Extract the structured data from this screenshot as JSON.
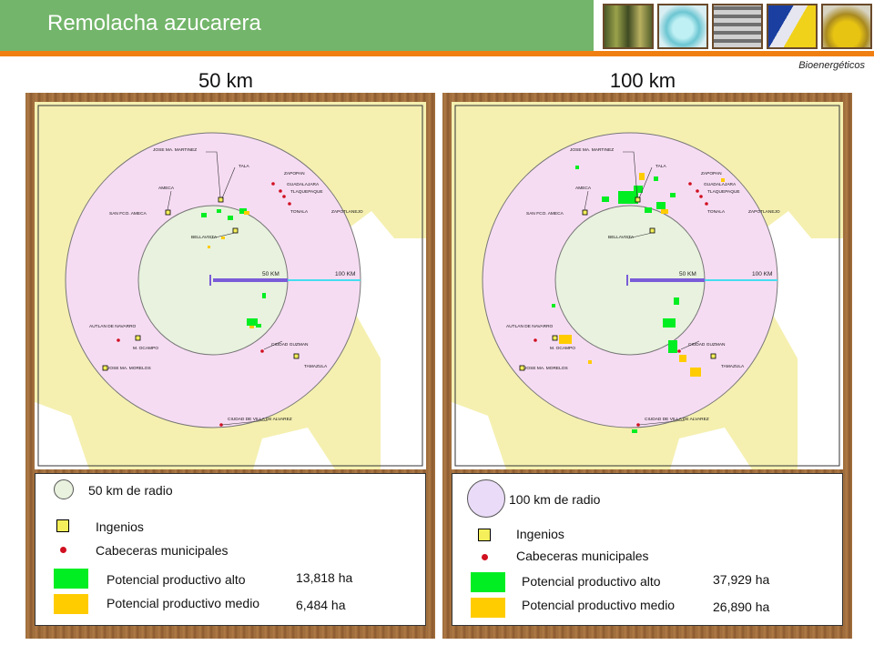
{
  "header": {
    "title": "Remolacha azucarera",
    "brand": "Bioenergéticos"
  },
  "colors": {
    "green_bar": "#73b56a",
    "orange_line": "#f07f12",
    "circle_50": "#e8f2de",
    "circle_100": "#f6dcf3",
    "yellow_land": "#f5f0b0",
    "high": "#00ee22",
    "medium": "#ffcc00"
  },
  "maps": [
    {
      "title": "50 km",
      "legend": {
        "radius_label": "50 km de radio",
        "mills": "Ingenios",
        "towns": "Cabeceras municipales",
        "high_label": "Potencial productivo alto",
        "medium_label": "Potencial productivo medio",
        "high_value": "13,818 ha",
        "medium_value": "6,484 ha"
      }
    },
    {
      "title": "100 km",
      "legend": {
        "radius_label": "100 km de radio",
        "mills": "Ingenios",
        "towns": "Cabeceras municipales",
        "high_label": "Potencial productivo alto",
        "medium_label": "Potencial productivo medio",
        "high_value": "37,929 ha",
        "medium_value": "26,890 ha"
      }
    }
  ],
  "map_labels": {
    "inner_ring": "50 KM",
    "outer_ring": "100 KM",
    "mills": [
      "JOSE MA. MARTINEZ",
      "TALA",
      "AMECA",
      "SAN FCO. AMECA",
      "BELLAVISTA",
      "M. OCAMPO",
      "JOSE MA. MORELOS",
      "TAMAZULA"
    ],
    "towns": [
      "ZAPOPAN",
      "GUADALAJARA",
      "TLAQUEPAQUE",
      "TONALA",
      "ZAPOTLANEJO",
      "AUTLAN DE NAVARRO",
      "CIUDAD GUZMAN",
      "CIUDAD DE VILLA DE ALVAREZ"
    ]
  }
}
